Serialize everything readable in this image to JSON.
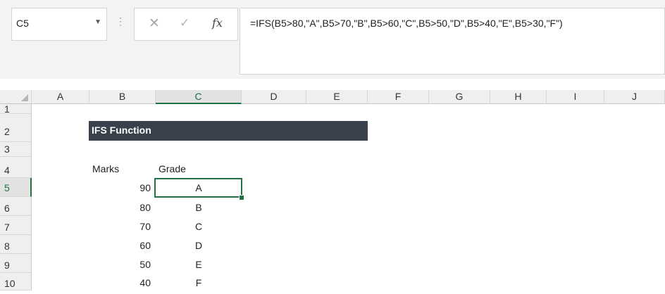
{
  "name_box": {
    "value": "C5",
    "dropdown_icon": "triangle-down-icon"
  },
  "formula_bar": {
    "cancel_icon": "close-icon",
    "enter_icon": "check-icon",
    "fx_label": "fx",
    "formula": "=IFS(B5>80,\"A\",B5>70,\"B\",B5>60,\"C\",B5>50,\"D\",B5>40,\"E\",B5>30,\"F\")"
  },
  "columns": [
    "A",
    "B",
    "C",
    "D",
    "E",
    "F",
    "G",
    "H",
    "I",
    "J"
  ],
  "rows": [
    "1",
    "2",
    "3",
    "4",
    "5",
    "6",
    "7",
    "8",
    "9",
    "10"
  ],
  "selected": {
    "cell": "C5",
    "column": "C",
    "row": "5"
  },
  "sheet": {
    "title": "IFS Function",
    "marks_header": "Marks",
    "grade_header": "Grade",
    "marks": [
      "90",
      "80",
      "70",
      "60",
      "50",
      "40"
    ],
    "grades": [
      "A",
      "B",
      "C",
      "D",
      "E",
      "F"
    ]
  },
  "colors": {
    "accent": "#217346",
    "title_bg": "#38414c"
  }
}
